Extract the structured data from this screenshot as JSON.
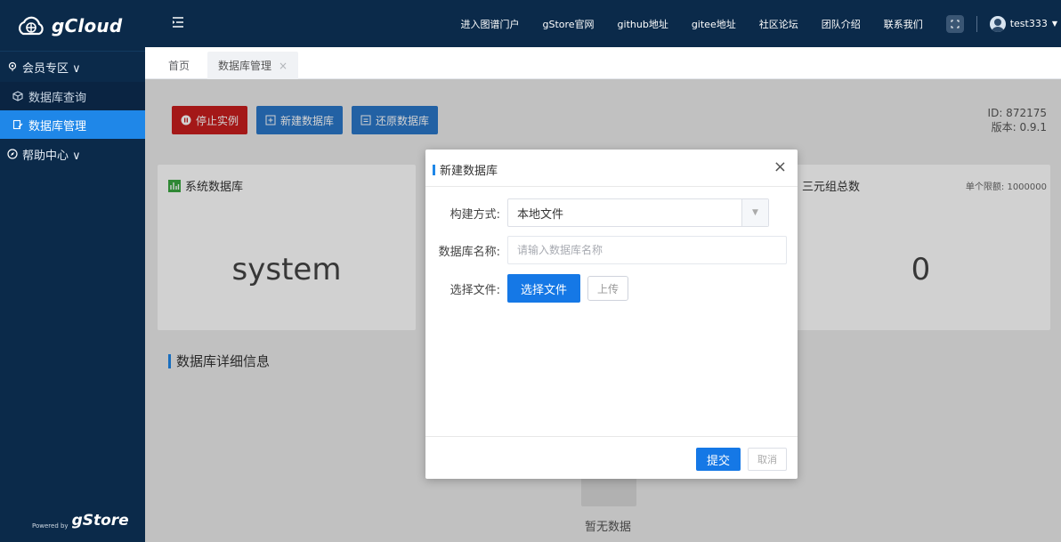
{
  "app": {
    "logo_text": "gCloud",
    "powered_by_small": "Powered by",
    "powered_by_brand": "gStore"
  },
  "sidebar": {
    "groups": [
      {
        "label": "会员专区 ∨"
      },
      {
        "label": "帮助中心 ∨"
      }
    ],
    "items": [
      {
        "label": "数据库查询"
      },
      {
        "label": "数据库管理",
        "active": true
      }
    ]
  },
  "topnav": {
    "links": [
      "进入图谱门户",
      "gStore官网",
      "github地址",
      "gitee地址",
      "社区论坛",
      "团队介绍",
      "联系我们"
    ],
    "username": "test333"
  },
  "tabs": [
    {
      "label": "首页"
    },
    {
      "label": "数据库管理",
      "close": "×"
    }
  ],
  "toolbar": {
    "stop_label": "停止实例",
    "new_db_label": "新建数据库",
    "restore_label": "还原数据库"
  },
  "instance": {
    "id_line": "ID: 872175",
    "version_line": "版本: 0.9.1"
  },
  "cards": {
    "system_db_title": "系统数据库",
    "system_db_value": "system",
    "triples_title": "三元组总数",
    "triples_limit": "单个限额: 1000000",
    "triples_value": "0"
  },
  "details": {
    "title": "数据库详细信息",
    "empty_text": "暂无数据"
  },
  "modal": {
    "title": "新建数据库",
    "close": "×",
    "build_label": "构建方式:",
    "build_value": "本地文件",
    "name_label": "数据库名称:",
    "name_placeholder": "请输入数据库名称",
    "file_label": "选择文件:",
    "choose_file": "选择文件",
    "upload": "上传",
    "submit": "提交",
    "cancel": "取消"
  },
  "colors": {
    "sidebar_bg": "#0b2a4a",
    "primary": "#1578e6",
    "danger": "#c81e1e"
  }
}
